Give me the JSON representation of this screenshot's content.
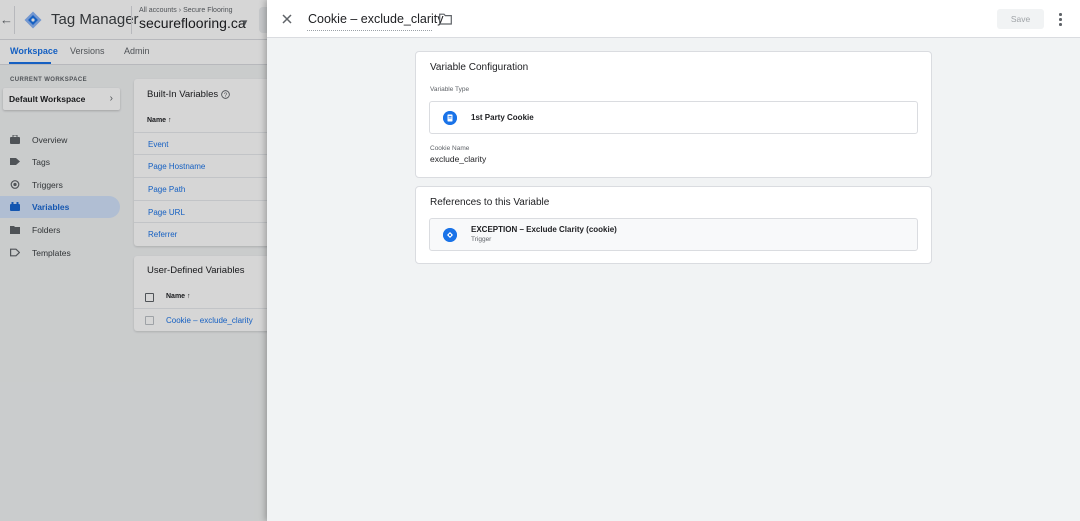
{
  "app": {
    "product_name": "Tag Manager",
    "breadcrumb": [
      "All accounts",
      "Secure Flooring"
    ],
    "container_name": "secureflooring.ca",
    "nav_tabs": [
      {
        "label": "Workspace",
        "active": true
      },
      {
        "label": "Versions",
        "active": false
      },
      {
        "label": "Admin",
        "active": false
      }
    ],
    "current_workspace_label": "CURRENT WORKSPACE",
    "workspace_name": "Default Workspace",
    "sidebar": [
      {
        "label": "Overview",
        "icon": "briefcase-icon",
        "active": false
      },
      {
        "label": "Tags",
        "icon": "tag-icon",
        "active": false
      },
      {
        "label": "Triggers",
        "icon": "trigger-icon",
        "active": false
      },
      {
        "label": "Variables",
        "icon": "variables-icon",
        "active": true
      },
      {
        "label": "Folders",
        "icon": "folder-icon",
        "active": false
      },
      {
        "label": "Templates",
        "icon": "template-icon",
        "active": false
      }
    ],
    "builtin": {
      "title": "Built-In Variables",
      "column": "Name",
      "rows": [
        "Event",
        "Page Hostname",
        "Page Path",
        "Page URL",
        "Referrer"
      ]
    },
    "user_defined": {
      "title": "User-Defined Variables",
      "column": "Name",
      "rows": [
        "Cookie – exclude_clarity"
      ]
    }
  },
  "panel": {
    "title": "Cookie – exclude_clarity",
    "save_label": "Save",
    "config": {
      "title": "Variable Configuration",
      "type_label": "Variable Type",
      "type_value": "1st Party Cookie",
      "cookie_name_label": "Cookie Name",
      "cookie_name_value": "exclude_clarity"
    },
    "references": {
      "title": "References to this Variable",
      "items": [
        {
          "name": "EXCEPTION – Exclude Clarity (cookie)",
          "type": "Trigger"
        }
      ]
    }
  },
  "colors": {
    "accent": "#1a73e8",
    "active_nav_bg": "#d2e3fc",
    "panel_bg": "#f1f3f4"
  }
}
